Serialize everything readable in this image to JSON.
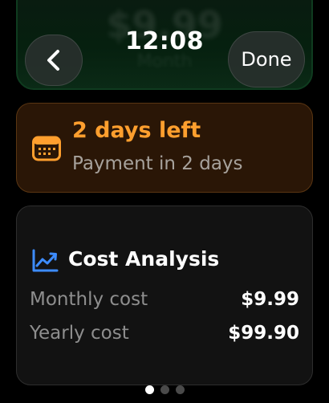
{
  "background_card": {
    "price": "$9.99",
    "unit": "Month"
  },
  "header": {
    "time": "12:08",
    "back_icon": "chevron-left-icon",
    "done_label": "Done"
  },
  "due_card": {
    "icon": "calendar-icon",
    "title": "2 days left",
    "subtitle": "Payment in 2 days",
    "accent_color": "#ff9f2e"
  },
  "cost_card": {
    "icon": "chart-line-icon",
    "title": "Cost Analysis",
    "rows": [
      {
        "label": "Monthly cost",
        "value": "$9.99"
      },
      {
        "label": "Yearly cost",
        "value": "$99.90"
      }
    ]
  },
  "pager": {
    "total": 3,
    "active_index": 0
  }
}
